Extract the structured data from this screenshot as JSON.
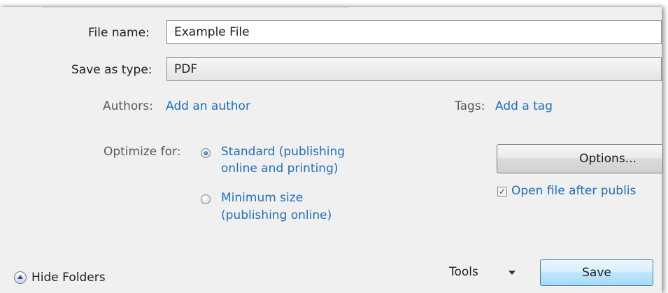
{
  "file_name": {
    "label": "File name:",
    "value": "Example File"
  },
  "save_as_type": {
    "label": "Save as type:",
    "value": "PDF"
  },
  "authors": {
    "label": "Authors:",
    "value": "Add an author"
  },
  "tags": {
    "label": "Tags:",
    "value": "Add a tag"
  },
  "optimize": {
    "label": "Optimize for:",
    "options": [
      {
        "line1": "Standard (publishing",
        "line2": "online and printing)",
        "selected": true
      },
      {
        "line1": "Minimum size",
        "line2": "(publishing online)",
        "selected": false
      }
    ]
  },
  "options_button": "Options...",
  "open_after": {
    "label": "Open file after publis",
    "checked": true,
    "check_glyph": "✓"
  },
  "hide_folders": "Hide Folders",
  "tools": "Tools",
  "save": "Save",
  "colors": {
    "link": "#1f6fc0",
    "dialog_bg": "#f0f0f0"
  }
}
